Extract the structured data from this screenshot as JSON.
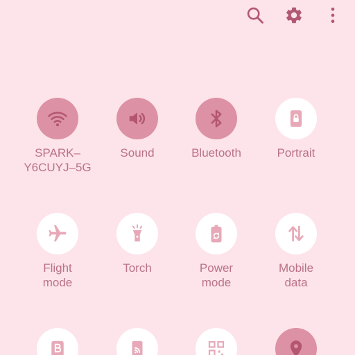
{
  "colors": {
    "background": "#fde3ea",
    "tile_on": "#dc91a5",
    "tile_off": "#ffffff",
    "icon_on": "#b4566f",
    "icon_off": "#e7a9b8",
    "label": "#b97386",
    "top_icon": "#b15873"
  },
  "top_actions": [
    {
      "icon": "search-icon"
    },
    {
      "icon": "gear-icon"
    },
    {
      "icon": "more-vert-icon"
    }
  ],
  "tiles": [
    {
      "label": "SPARK–\nY6CUYJ–5G",
      "icon": "wifi-icon",
      "active": true
    },
    {
      "label": "Sound",
      "icon": "sound-icon",
      "active": true
    },
    {
      "label": "Bluetooth",
      "icon": "bluetooth-icon",
      "active": true
    },
    {
      "label": "Portrait",
      "icon": "portrait-lock-icon",
      "active": false
    },
    {
      "label": "Flight\nmode",
      "icon": "airplane-icon",
      "active": false
    },
    {
      "label": "Torch",
      "icon": "flashlight-icon",
      "active": false
    },
    {
      "label": "Power\nmode",
      "icon": "battery-recycle-icon",
      "active": false
    },
    {
      "label": "Mobile\ndata",
      "icon": "mobile-data-icon",
      "active": false
    },
    {
      "icon": "b-icon",
      "active": false
    },
    {
      "icon": "cast-icon",
      "active": false
    },
    {
      "icon": "qr-code-icon",
      "active": false
    },
    {
      "icon": "location-icon",
      "active": true
    }
  ]
}
